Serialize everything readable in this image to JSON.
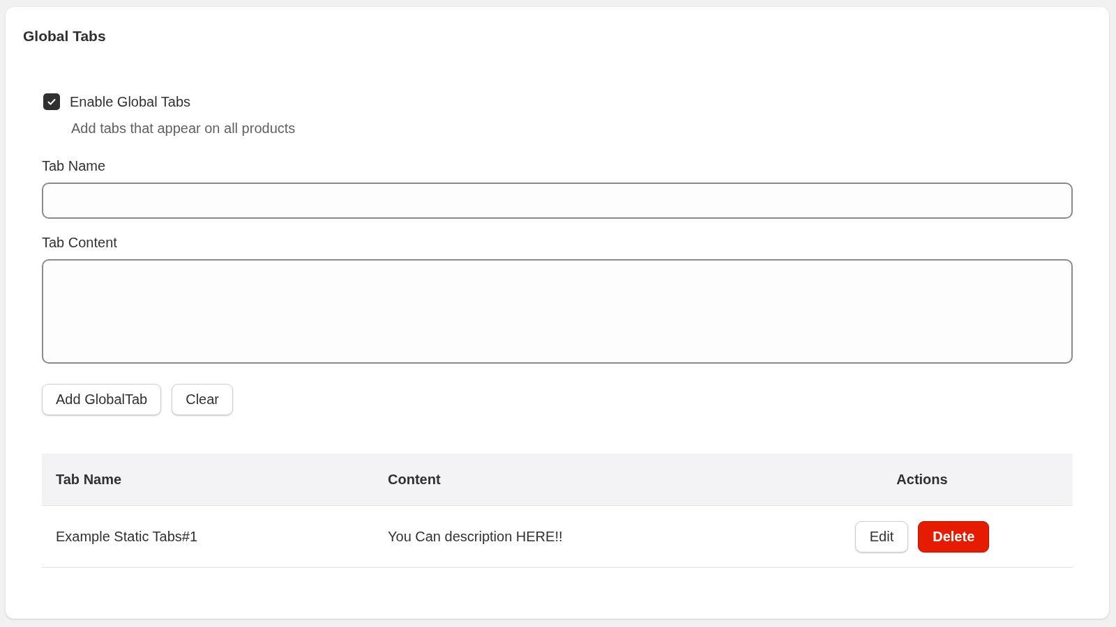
{
  "card": {
    "title": "Global Tabs"
  },
  "enable": {
    "label": "Enable Global Tabs",
    "checked": true,
    "help": "Add tabs that appear on all products"
  },
  "fields": [
    {
      "label": "Tab Name",
      "kind": "input"
    },
    {
      "label": "Tab Content",
      "kind": "textarea"
    }
  ],
  "buttons": [
    "Add GlobalTab",
    "Clear"
  ],
  "table": {
    "columns": [
      "Tab Name",
      "Content",
      "Actions"
    ],
    "rows": [
      {
        "cells": [
          "Example Static Tabs#1",
          "You Can description HERE!!"
        ],
        "actions": [
          {
            "label": "Edit",
            "kind": "secondary"
          },
          {
            "label": "Delete",
            "kind": "critical"
          }
        ]
      }
    ]
  }
}
